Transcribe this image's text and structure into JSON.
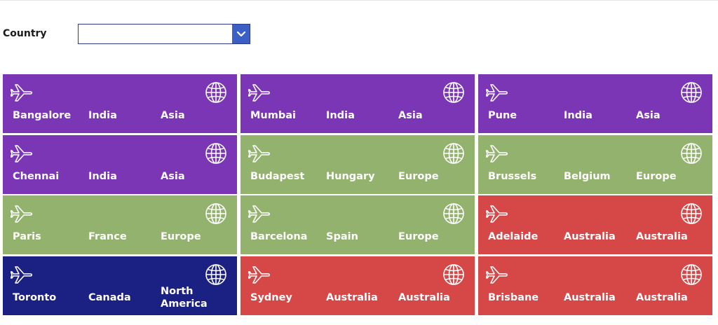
{
  "filter": {
    "label": "Country",
    "value": ""
  },
  "colors": {
    "Asia": "#7b36b6",
    "Europe": "#93b26d",
    "Australia": "#d64747",
    "North America": "#1b2183",
    "dropdown_button": "#3b5fc5",
    "dropdown_border": "#2b3a8f"
  },
  "cards": [
    {
      "city": "Bangalore",
      "country": "India",
      "continent": "Asia"
    },
    {
      "city": "Mumbai",
      "country": "India",
      "continent": "Asia"
    },
    {
      "city": "Pune",
      "country": "India",
      "continent": "Asia"
    },
    {
      "city": "Chennai",
      "country": "India",
      "continent": "Asia"
    },
    {
      "city": "Budapest",
      "country": "Hungary",
      "continent": "Europe"
    },
    {
      "city": "Brussels",
      "country": "Belgium",
      "continent": "Europe"
    },
    {
      "city": "Paris",
      "country": "France",
      "continent": "Europe"
    },
    {
      "city": "Barcelona",
      "country": "Spain",
      "continent": "Europe"
    },
    {
      "city": "Adelaide",
      "country": "Australia",
      "continent": "Australia"
    },
    {
      "city": "Toronto",
      "country": "Canada",
      "continent": "North America"
    },
    {
      "city": "Sydney",
      "country": "Australia",
      "continent": "Australia"
    },
    {
      "city": "Brisbane",
      "country": "Australia",
      "continent": "Australia"
    }
  ],
  "icons": {
    "left": "airplane-icon",
    "right": "globe-icon",
    "dropdown": "chevron-down-icon"
  }
}
